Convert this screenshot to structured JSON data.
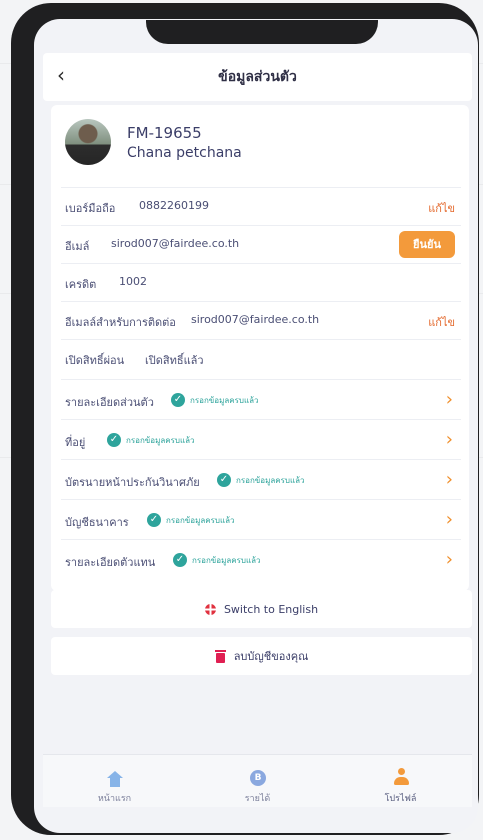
{
  "header": {
    "title": "ข้อมูลส่วนตัว",
    "back": "‹"
  },
  "profile": {
    "code": "FM-19655",
    "name": "Chana petchana"
  },
  "rows": [
    {
      "label": "เบอร์มือถือ",
      "value": "0882260199",
      "action": "แก้ไข"
    },
    {
      "label": "อีเมล์",
      "value": "sirod007@fairdee.co.th",
      "action": "ยืนยัน"
    },
    {
      "label": "เครดิต",
      "value": "1002"
    },
    {
      "label": "อีเมลล์สำหรับการติดต่อ",
      "value": "sirod007@fairdee.co.th",
      "action": "แก้ไข"
    },
    {
      "label": "เปิดสิทธิ์ผ่อน",
      "value": "เปิดสิทธิ์แล้ว"
    }
  ],
  "sections": [
    {
      "label": "รายละเอียดส่วนตัว",
      "status": "กรอกข้อมูลครบแล้ว"
    },
    {
      "label": "ที่อยู่",
      "status": "กรอกข้อมูลครบแล้ว"
    },
    {
      "label": "บัตรนายหน้าประกันวินาศภัย",
      "status": "กรอกข้อมูลครบแล้ว"
    },
    {
      "label": "บัญชีธนาคาร",
      "status": "กรอกข้อมูลครบแล้ว"
    },
    {
      "label": "รายละเอียดตัวแทน",
      "status": "กรอกข้อมูลครบแล้ว"
    }
  ],
  "buttons": {
    "switch_language": "Switch to English",
    "delete_account": "ลบบัญชีของคุณ"
  },
  "tabs": [
    {
      "label": "หน้าแรก",
      "icon": "home-icon"
    },
    {
      "label": "รายได้",
      "icon": "coin-icon",
      "glyph": "B"
    },
    {
      "label": "โปรไฟล์",
      "icon": "person-icon",
      "active": true
    }
  ],
  "colors": {
    "accent": "#f39a3b",
    "ok": "#2ea49c",
    "edit": "#e46a2e",
    "delete": "#e01f52"
  }
}
